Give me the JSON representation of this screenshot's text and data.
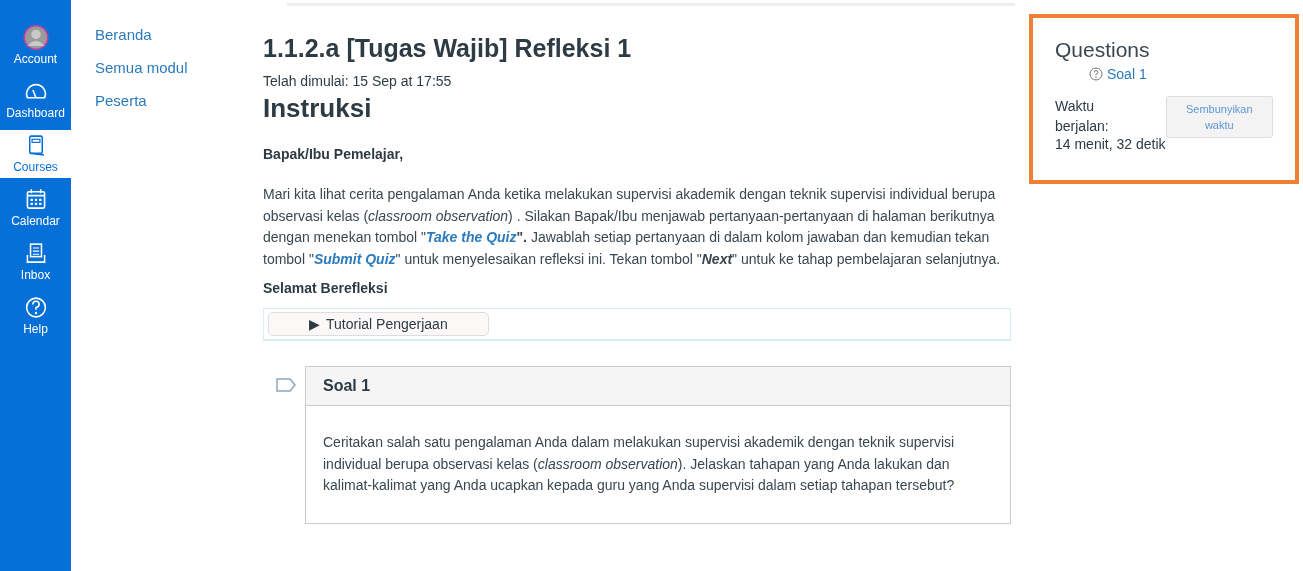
{
  "global_nav": [
    {
      "label": "Account",
      "kind": "avatar",
      "selected": false
    },
    {
      "label": "Dashboard",
      "kind": "gauge",
      "selected": false
    },
    {
      "label": "Courses",
      "kind": "book",
      "selected": true
    },
    {
      "label": "Calendar",
      "kind": "calendar",
      "selected": false
    },
    {
      "label": "Inbox",
      "kind": "inbox",
      "selected": false
    },
    {
      "label": "Help",
      "kind": "help",
      "selected": false
    }
  ],
  "course_nav": [
    "Beranda",
    "Semua modul",
    "Peserta"
  ],
  "quiz": {
    "title": "1.1.2.a [Tugas Wajib] Refleksi 1",
    "started": "Telah dimulai: 15 Sep at 17:55",
    "heading": "Instruksi",
    "greeting": "Bapak/Ibu Pemelajar,",
    "paragraph": [
      {
        "kind": "text",
        "text": "Mari kita lihat  cerita pengalaman Anda ketika melakukan supervisi akademik dengan teknik supervisi individual berupa observasi kelas (*classroom observation*) . Silakan Bapak/Ibu menjawab pertanyaan-pertanyaan di halaman berikutnya dengan menekan tombol \""
      },
      {
        "kind": "link",
        "text": "Take the Quiz"
      },
      {
        "kind": "text",
        "text": "**\".** Jawablah setiap pertanyaan di dalam kolom jawaban dan kemudian tekan tombol \""
      },
      {
        "kind": "link",
        "text": "Submit Quiz"
      },
      {
        "kind": "text",
        "text": "\" untuk menyelesaikan refleksi ini. Tekan tombol \""
      },
      {
        "kind": "emphasis",
        "text": "Next"
      },
      {
        "kind": "text",
        "text": "\" untuk ke tahap pembelajaran selanjutnya."
      }
    ],
    "closing": "Selamat Berefleksi",
    "details": {
      "marker": "▶",
      "label": "Tutorial Pengerjaan",
      "expanded": false
    },
    "question": {
      "title": "Soal 1",
      "text": "Ceritakan salah satu pengalaman Anda dalam melakukan supervisi akademik dengan teknik supervisi individual berupa observasi kelas (*classroom observation*). Jelaskan tahapan yang Anda lakukan dan kalimat-kalimat yang Anda ucapkan kepada guru yang Anda supervisi dalam setiap tahapan tersebut?"
    }
  },
  "side_panel": {
    "title": "Questions",
    "questions": [
      "Soal 1"
    ],
    "timer_label": "Waktu berjalan:",
    "timer_value": "14 menit, 32 detik",
    "hide_button": "Sembunyikan waktu"
  }
}
